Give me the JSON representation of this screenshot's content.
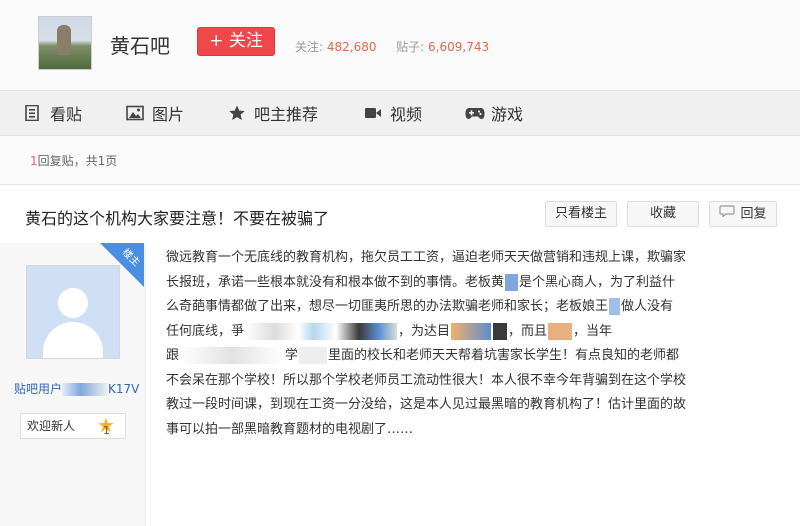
{
  "forum": {
    "name": "黄石吧",
    "follow_label": "+ 关注",
    "followers_label": "关注:",
    "followers": "482,680",
    "posts_label": "贴子:",
    "posts": "6,609,743"
  },
  "nav": {
    "items": [
      {
        "label": "看贴",
        "icon": "document-icon"
      },
      {
        "label": "图片",
        "icon": "image-icon"
      },
      {
        "label": "吧主推荐",
        "icon": "star-icon"
      },
      {
        "label": "视频",
        "icon": "video-icon"
      },
      {
        "label": "游戏",
        "icon": "gamepad-icon"
      }
    ]
  },
  "thread": {
    "reply_count": "1",
    "reply_text": "回复贴，共",
    "page_count": "1",
    "page_suffix": "页",
    "title": "黄石的这个机构大家要注意！不要在被骗了",
    "buttons": {
      "only_op": "只看楼主",
      "favorite": "收藏",
      "reply": "回复"
    }
  },
  "post": {
    "badge": "楼主",
    "username_prefix": "贴吧用户",
    "username_suffix": "K17V",
    "welcome": "欢迎新人",
    "level": "1",
    "lines": {
      "l1": "微远教育一个无底线的教育机构，拖欠员工工资，逼迫老师天天做营销和违规上课，欺骗家",
      "l2a": "长报班，承诺一些根本就没有和根本做不到的事情。老板黄",
      "l2b": "是个黑心商人，为了利益什",
      "l3a": "么奇葩事情都做了出来，想尽一切匪夷所思的办法欺骗老师和家长；老板娘王",
      "l3b": "做人没有",
      "l4a": "任何底线，爭",
      "l4b": "，为达目",
      "l4c": "，而且",
      "l4d": "，当年",
      "l5a": "跟",
      "l5b": "学",
      "l5c": "里面的校长和老师天天帮着坑害家长学生！有点良知的老师都",
      "l6": "不会呆在那个学校！所以那个学校老师员工流动性很大！本人很不幸今年背骗到在这个学校",
      "l7": "教过一段时间课，到现在工资一分没给，这是本人见过最黑暗的教育机构了！估计里面的故",
      "l8": "事可以拍一部黑暗教育题材的电视剧了……"
    }
  },
  "colors": {
    "accent_red": "#f0484a",
    "link_blue": "#3366bb",
    "badge_blue": "#4a90e2",
    "count_orange": "#e0694f"
  }
}
